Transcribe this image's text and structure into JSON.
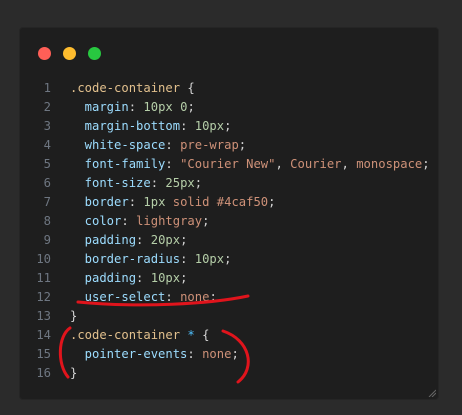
{
  "window_controls": {
    "close": "close-dot",
    "minimize": "minimize-dot",
    "maximize": "maximize-dot"
  },
  "code": {
    "lines": [
      {
        "n": "1",
        "parts": [
          {
            "t": ".code-container",
            "c": "sel"
          },
          {
            "t": " {",
            "c": "punc"
          }
        ]
      },
      {
        "n": "2",
        "parts": [
          {
            "t": "  margin",
            "c": "prop"
          },
          {
            "t": ": ",
            "c": "punc"
          },
          {
            "t": "10px",
            "c": "val"
          },
          {
            "t": " ",
            "c": "punc"
          },
          {
            "t": "0",
            "c": "val"
          },
          {
            "t": ";",
            "c": "punc"
          }
        ]
      },
      {
        "n": "3",
        "parts": [
          {
            "t": "  margin-bottom",
            "c": "prop"
          },
          {
            "t": ": ",
            "c": "punc"
          },
          {
            "t": "10px",
            "c": "val"
          },
          {
            "t": ";",
            "c": "punc"
          }
        ]
      },
      {
        "n": "4",
        "parts": [
          {
            "t": "  white-space",
            "c": "prop"
          },
          {
            "t": ": ",
            "c": "punc"
          },
          {
            "t": "pre-wrap",
            "c": "kw"
          },
          {
            "t": ";",
            "c": "punc"
          }
        ]
      },
      {
        "n": "5",
        "parts": [
          {
            "t": "  font-family",
            "c": "prop"
          },
          {
            "t": ": ",
            "c": "punc"
          },
          {
            "t": "\"Courier New\"",
            "c": "str"
          },
          {
            "t": ", ",
            "c": "punc"
          },
          {
            "t": "Courier",
            "c": "kw"
          },
          {
            "t": ", ",
            "c": "punc"
          },
          {
            "t": "monospace",
            "c": "kw"
          },
          {
            "t": ";",
            "c": "punc"
          }
        ]
      },
      {
        "n": "6",
        "parts": [
          {
            "t": "  font-size",
            "c": "prop"
          },
          {
            "t": ": ",
            "c": "punc"
          },
          {
            "t": "25px",
            "c": "val"
          },
          {
            "t": ";",
            "c": "punc"
          }
        ]
      },
      {
        "n": "7",
        "parts": [
          {
            "t": "  border",
            "c": "prop"
          },
          {
            "t": ": ",
            "c": "punc"
          },
          {
            "t": "1px",
            "c": "val"
          },
          {
            "t": " ",
            "c": "punc"
          },
          {
            "t": "solid",
            "c": "kw"
          },
          {
            "t": " ",
            "c": "punc"
          },
          {
            "t": "#4caf50",
            "c": "kw"
          },
          {
            "t": ";",
            "c": "punc"
          }
        ]
      },
      {
        "n": "8",
        "parts": [
          {
            "t": "  color",
            "c": "prop"
          },
          {
            "t": ": ",
            "c": "punc"
          },
          {
            "t": "lightgray",
            "c": "kw"
          },
          {
            "t": ";",
            "c": "punc"
          }
        ]
      },
      {
        "n": "9",
        "parts": [
          {
            "t": "  padding",
            "c": "prop"
          },
          {
            "t": ": ",
            "c": "punc"
          },
          {
            "t": "20px",
            "c": "val"
          },
          {
            "t": ";",
            "c": "punc"
          }
        ]
      },
      {
        "n": "10",
        "parts": [
          {
            "t": "  border-radius",
            "c": "prop"
          },
          {
            "t": ": ",
            "c": "punc"
          },
          {
            "t": "10px",
            "c": "val"
          },
          {
            "t": ";",
            "c": "punc"
          }
        ]
      },
      {
        "n": "11",
        "parts": [
          {
            "t": "  padding",
            "c": "prop"
          },
          {
            "t": ": ",
            "c": "punc"
          },
          {
            "t": "10px",
            "c": "val"
          },
          {
            "t": ";",
            "c": "punc"
          }
        ]
      },
      {
        "n": "12",
        "parts": [
          {
            "t": "  user-select",
            "c": "prop"
          },
          {
            "t": ": ",
            "c": "punc"
          },
          {
            "t": "none",
            "c": "kw"
          },
          {
            "t": ";",
            "c": "punc"
          }
        ]
      },
      {
        "n": "13",
        "parts": [
          {
            "t": "}",
            "c": "punc"
          }
        ]
      },
      {
        "n": "14",
        "parts": [
          {
            "t": ".code-container",
            "c": "sel"
          },
          {
            "t": " ",
            "c": "punc"
          },
          {
            "t": "*",
            "c": "star"
          },
          {
            "t": " {",
            "c": "punc"
          }
        ]
      },
      {
        "n": "15",
        "parts": [
          {
            "t": "  pointer-events",
            "c": "prop"
          },
          {
            "t": ": ",
            "c": "punc"
          },
          {
            "t": "none",
            "c": "kw"
          },
          {
            "t": ";",
            "c": "punc"
          }
        ]
      },
      {
        "n": "16",
        "parts": [
          {
            "t": "}",
            "c": "punc"
          }
        ]
      }
    ]
  },
  "colors": {
    "annotation": "#e0141c",
    "background": "#1e1e1e"
  }
}
